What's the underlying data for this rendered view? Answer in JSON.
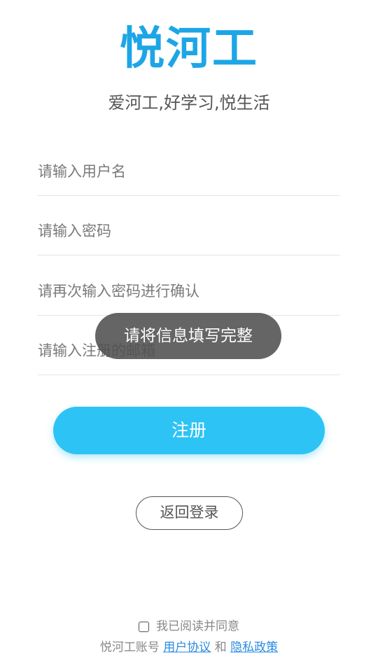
{
  "header": {
    "logo_text": "悦河工",
    "slogan": "爱河工,好学习,悦生活"
  },
  "form": {
    "username_placeholder": "请输入用户名",
    "password_placeholder": "请输入密码",
    "confirm_password_placeholder": "请再次输入密码进行确认",
    "email_placeholder": "请输入注册的邮箱"
  },
  "actions": {
    "register_label": "注册",
    "back_label": "返回登录"
  },
  "toast": {
    "message": "请将信息填写完整"
  },
  "agreement": {
    "checkbox_label": "我已阅读并同意",
    "prefix": "悦河工账号",
    "user_agreement": "用户协议",
    "and": "和",
    "privacy_policy": "隐私政策"
  },
  "colors": {
    "brand": "#1da6e6",
    "button": "#2ec3f5",
    "link": "#2c8be0"
  }
}
